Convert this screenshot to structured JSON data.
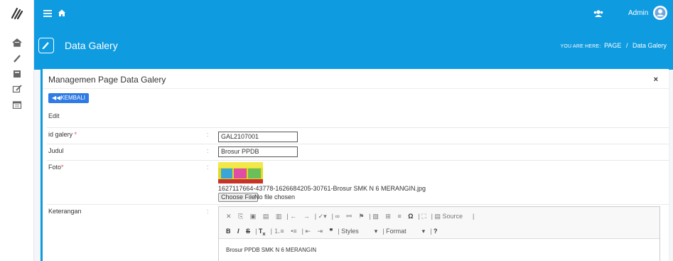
{
  "topbar": {
    "admin_label": "Admin"
  },
  "sidebar": {
    "items": [
      "home",
      "edit",
      "book",
      "pencil",
      "calendar"
    ]
  },
  "header": {
    "title": "Data Galery",
    "breadcrumb_prefix": "YOU ARE HERE:",
    "breadcrumb_page": "PAGE",
    "breadcrumb_sep": "/",
    "breadcrumb_current": "Data Galery"
  },
  "card": {
    "title": "Managemen Page Data Galery",
    "close": "×",
    "back_label": "KEMBALI",
    "edit_label": "Edit"
  },
  "form": {
    "id_label": "id galery",
    "id_req": "*",
    "id_value": "GAL2107001",
    "judul_label": "Judul",
    "judul_value": "Brosur PPDB",
    "foto_label": "Foto",
    "foto_req": "*",
    "foto_filename": "1627117664-43778-1626684205-30761-Brosur SMK N 6 MERANGIN.jpg",
    "choose_file": "Choose File",
    "no_file": "No file chosen",
    "keterangan_label": "Keterangan",
    "colon": ":"
  },
  "editor": {
    "source_label": "Source",
    "styles_label": "Styles",
    "format_label": "Format",
    "content": "Brosur PPDB SMK N 6 MERANGIN"
  }
}
